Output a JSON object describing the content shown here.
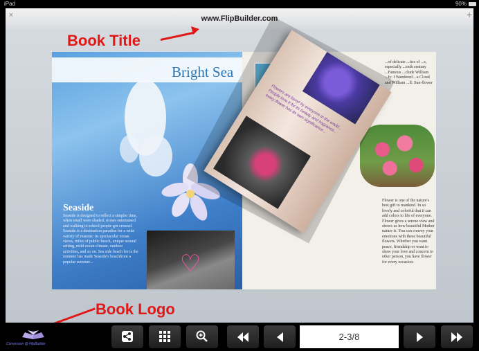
{
  "status_bar": {
    "carrier": "iPad",
    "battery_text": "90%"
  },
  "browser": {
    "book_url": "www.FlipBuilder.com"
  },
  "annotations": {
    "book_title": "Book Title",
    "book_logo": "Book Logo"
  },
  "book": {
    "spread_title": "Bright Sea",
    "left_heading": "Seaside",
    "left_body": "Seaside is designed to reflect a simpler time, when small were shaded, stones entertained and walking to school people got crossed. Seaside is a destination paradise for a wide variety of reasons: its spectacular ocean views, miles of public beach, unique natural setting, mild ocean climate, outdoor activities, and so on. Sea side beach for is the summer has made Seaside's beachfront a popular summer...",
    "right_top_text": "...of delicate ...tics of ...s, especially ...enth century ...Famous ...clude William ...ly: I Wandered ...a Cloud and William ...ll: Sun-flower",
    "right_bottom_text": "Flower is one of the nature's best gift to mankind. In so lovely and colorful that it can add colors to life of everyone. Flower gives a serene view and shows us how beautiful Mother nature is. You can convey your emotions with these beautiful flowers. Whether you want peace, friendship or want to show your love and concern to other person, you have flower for every occasion.",
    "curl_text": "Flowers are loved by everyone in the world... People love it for its beauty and fragrance... every flower has its own significance..."
  },
  "logo_caption": "Conversion @ FlipBuilder",
  "toolbar": {
    "share_icon": "share-icon",
    "thumbnails_icon": "grid-icon",
    "zoom_icon": "zoom-in-icon",
    "first_icon": "first-page-icon",
    "prev_icon": "prev-page-icon",
    "page_value": "2-3/8",
    "next_icon": "next-page-icon",
    "last_icon": "last-page-icon"
  },
  "colors": {
    "annotation": "#e01818",
    "toolbar": "#1f1f1f",
    "title_blue": "#2a77b8"
  }
}
